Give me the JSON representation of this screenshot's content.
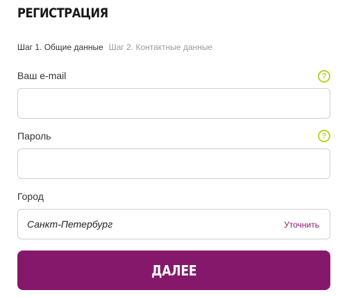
{
  "page": {
    "title": "РЕГИСТРАЦИЯ"
  },
  "steps": {
    "active": "Шаг 1. Общие данные",
    "inactive": "Шаг 2. Контактные данные"
  },
  "form": {
    "email": {
      "label": "Ваш e-mail",
      "value": "",
      "help_icon": "question-circle-icon"
    },
    "password": {
      "label": "Пароль",
      "value": "",
      "help_icon": "question-circle-icon"
    },
    "city": {
      "label": "Город",
      "value": "Санкт-Петербург",
      "action_label": "Уточнить"
    },
    "submit_label": "ДАЛЕЕ"
  },
  "colors": {
    "accent": "#86186b",
    "help_icon": "#b8d424",
    "link": "#8a1a6a",
    "border": "#cfcfcf"
  }
}
